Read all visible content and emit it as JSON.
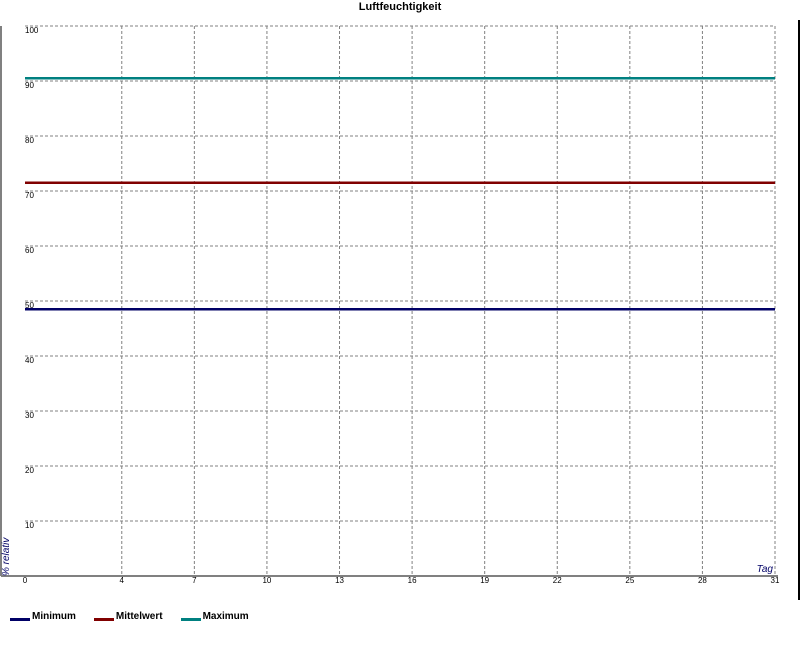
{
  "chart_data": {
    "type": "line",
    "title": "Luftfeuchtigkeit",
    "xlabel": "Tag",
    "ylabel": "% relativ",
    "xlim": [
      0,
      31
    ],
    "ylim": [
      0,
      100
    ],
    "x_ticks": [
      0,
      4,
      7,
      10,
      13,
      16,
      19,
      22,
      25,
      28,
      31
    ],
    "y_ticks": [
      10,
      20,
      30,
      40,
      50,
      60,
      70,
      80,
      90,
      100
    ],
    "grid": true,
    "legend_position": "bottom-left",
    "x": [
      0,
      31
    ],
    "series": [
      {
        "name": "Minimum",
        "color": "#000066",
        "values": [
          48.5,
          48.5
        ]
      },
      {
        "name": "Mittelwert",
        "color": "#800000",
        "values": [
          71.5,
          71.5
        ]
      },
      {
        "name": "Maximum",
        "color": "#008080",
        "values": [
          90.5,
          90.5
        ]
      }
    ]
  }
}
